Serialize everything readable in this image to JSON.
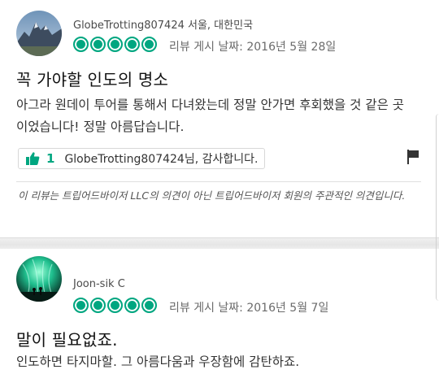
{
  "reviews": [
    {
      "username": "GlobeTrotting807424",
      "location": "서울, 대한민국",
      "rating": 5,
      "date_text": "리뷰 게시 날짜: 2016년 5월 28일",
      "title": "꼭 가야할 인도의 명소",
      "body": "아그라 원데이 투어를 통해서 다녀왔는데 정말 안가면 후회했을 것 같은 곳이었습니다! 정말 아름답습니다.",
      "thanks_count": "1",
      "thanks_text": "GlobeTrotting807424님, 감사합니다.",
      "disclaimer": "이 리뷰는 트립어드바이저 LLC의 의견이 아닌 트립어드바이저 회원의 주관적인 의견입니다."
    },
    {
      "username": "Joon-sik C",
      "rating": 5,
      "date_text": "리뷰 게시 날짜: 2016년 5월 7일",
      "title": "말이 필요없죠.",
      "body": "인도하면 타지마할. 그 아름다움과 우장함에 감탄하죠."
    }
  ],
  "colors": {
    "accent": "#00a680"
  },
  "icons": [
    "mountain-avatar",
    "aurora-avatar",
    "rating-bubble",
    "thumbs-up-icon",
    "flag-icon"
  ]
}
